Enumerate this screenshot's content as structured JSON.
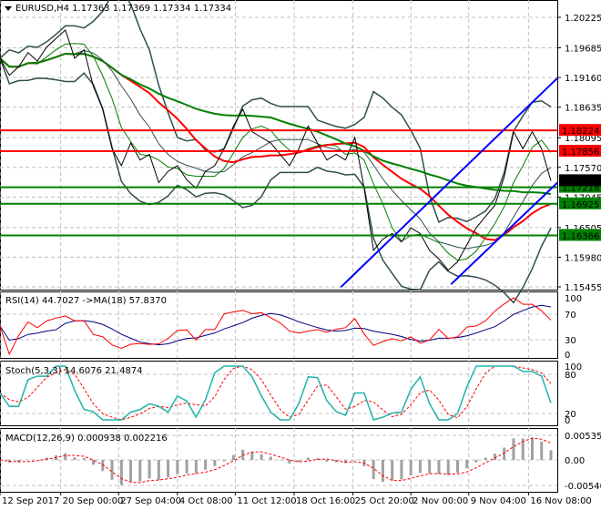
{
  "header": {
    "symbol": "EURUSD,H4",
    "ohlc": "1.17363 1.17369 1.17334 1.17334"
  },
  "chart_data": {
    "type": "line",
    "title": "EURUSD,H4 1.17363 1.17369 1.17334 1.17334",
    "price_axis": {
      "ylim": [
        1.15455,
        1.20225
      ],
      "ticks": [
        "1.20225",
        "1.19685",
        "1.19160",
        "1.18635",
        "1.18095",
        "1.17570",
        "1.17045",
        "1.16505",
        "1.15980",
        "1.15455"
      ]
    },
    "current_price": "1.17334",
    "levels": [
      {
        "price": 1.18224,
        "label": "1.18224",
        "color": "#ff0000"
      },
      {
        "price": 1.17856,
        "label": "1.17856",
        "color": "#ff0000"
      },
      {
        "price": 1.17218,
        "label": "1.17218",
        "color": "#008000"
      },
      {
        "price": 1.16925,
        "label": "1.16925",
        "color": "#008000"
      },
      {
        "price": 1.16366,
        "label": "1.16366",
        "color": "#008000"
      }
    ],
    "trendlines": [
      {
        "from": [
          36.5,
          1.1545
        ],
        "to": [
          59.7,
          1.1915
        ],
        "color": "#0000ff"
      },
      {
        "from": [
          48.3,
          1.155
        ],
        "to": [
          59.7,
          1.173
        ],
        "color": "#0000ff"
      }
    ],
    "x_labels": [
      "12 Sep 2017",
      "20 Sep 00:00",
      "27 Sep 04:00",
      "4 Oct 08:00",
      "11 Oct 12:00",
      "18 Oct 16:00",
      "25 Oct 20:00",
      "2 Nov 00:00",
      "9 Nov 04:00",
      "16 Nov 08:00"
    ],
    "x_label_index": [
      0,
      6.5,
      12.7,
      19,
      25.2,
      31.5,
      37.8,
      44,
      50.2,
      56.6
    ],
    "close": [
      1.195,
      1.192,
      1.1935,
      1.196,
      1.1945,
      1.197,
      1.1985,
      1.2,
      1.195,
      1.1965,
      1.19,
      1.186,
      1.179,
      1.176,
      1.18,
      1.177,
      1.178,
      1.173,
      1.175,
      1.176,
      1.1735,
      1.172,
      1.175,
      1.176,
      1.179,
      1.183,
      1.186,
      1.182,
      1.181,
      1.18,
      1.178,
      1.176,
      1.179,
      1.183,
      1.18,
      1.177,
      1.178,
      1.177,
      1.181,
      1.172,
      1.161,
      1.163,
      1.164,
      1.1625,
      1.165,
      1.164,
      1.161,
      1.1595,
      1.1575,
      1.159,
      1.162,
      1.165,
      1.167,
      1.169,
      1.174,
      1.182,
      1.179,
      1.182,
      1.179,
      1.1733
    ],
    "rsi": {
      "title": "RSI(14) 44.7027  ->MA(18) 57.8370",
      "ticks": [
        "100",
        "70",
        "30",
        "0"
      ]
    },
    "stoch": {
      "title": "Stoch(5,3,3) 14.6076 21.4874",
      "ticks": [
        "100",
        "80",
        "20",
        "0"
      ]
    },
    "macd": {
      "title": "MACD(12,26,9) 0.000938 0.002216",
      "ticks": [
        "0.005359",
        "0.00",
        "-0.005405"
      ]
    }
  }
}
